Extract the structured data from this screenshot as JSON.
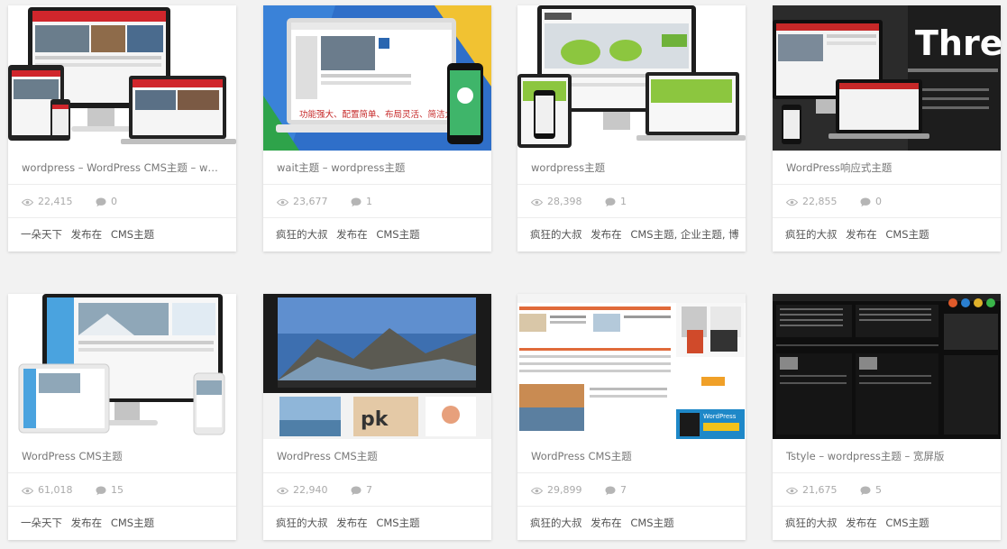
{
  "cards": [
    {
      "title": "wordpress – WordPress CMS主题 – wor…",
      "views": "22,415",
      "comments": "0",
      "author": "一朵天下",
      "posted_in": "发布在",
      "category": "CMS主题"
    },
    {
      "title": "wait主题 – wordpress主题",
      "views": "23,677",
      "comments": "1",
      "author": "疯狂的大叔",
      "posted_in": "发布在",
      "category": "CMS主题",
      "thumb_text": "功能强大、配置简单、布局灵活、简洁大气"
    },
    {
      "title": "wordpress主题",
      "views": "28,398",
      "comments": "1",
      "author": "疯狂的大叔",
      "posted_in": "发布在",
      "category": "CMS主题, 企业主题, 博"
    },
    {
      "title": "WordPress响应式主题",
      "views": "22,855",
      "comments": "0",
      "author": "疯狂的大叔",
      "posted_in": "发布在",
      "category": "CMS主题",
      "thumb_text": "Three"
    },
    {
      "title": "WordPress CMS主题",
      "views": "61,018",
      "comments": "15",
      "author": "一朵天下",
      "posted_in": "发布在",
      "category": "CMS主题"
    },
    {
      "title": "WordPress CMS主题",
      "views": "22,940",
      "comments": "7",
      "author": "疯狂的大叔",
      "posted_in": "发布在",
      "category": "CMS主题"
    },
    {
      "title": "WordPress CMS主题",
      "views": "29,899",
      "comments": "7",
      "author": "疯狂的大叔",
      "posted_in": "发布在",
      "category": "CMS主题",
      "thumb_text": "WordPress"
    },
    {
      "title": "Tstyle – wordpress主题 – 宽屏版",
      "views": "21,675",
      "comments": "5",
      "author": "疯狂的大叔",
      "posted_in": "发布在",
      "category": "CMS主题"
    }
  ],
  "icons": {
    "views": "eye-icon",
    "comments": "comment-bubble-icon"
  },
  "colors": {
    "background": "#f2f2f2",
    "card": "#ffffff",
    "muted_text": "#aaaaaa",
    "title_text": "#777777"
  }
}
